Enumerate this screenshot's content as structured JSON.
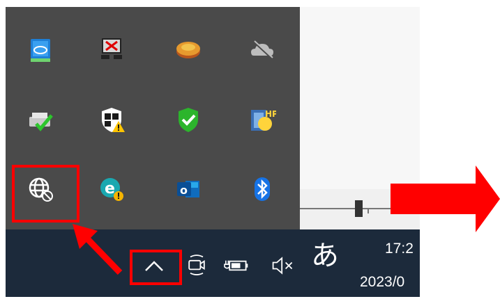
{
  "tray_overflow": {
    "icons": [
      {
        "name": "intel-graphics-icon",
        "row": 1,
        "col": 1
      },
      {
        "name": "network-disconnected-icon",
        "row": 1,
        "col": 2
      },
      {
        "name": "orange-disk-icon",
        "row": 1,
        "col": 3
      },
      {
        "name": "onedrive-offline-icon",
        "row": 1,
        "col": 4
      },
      {
        "name": "printer-check-icon",
        "row": 2,
        "col": 1
      },
      {
        "name": "windows-security-warning-icon",
        "row": 2,
        "col": 2
      },
      {
        "name": "shield-check-icon",
        "row": 2,
        "col": 3
      },
      {
        "name": "hp-app-icon",
        "row": 2,
        "col": 4
      },
      {
        "name": "globe-blocked-icon",
        "row": 3,
        "col": 1,
        "highlighted": true
      },
      {
        "name": "eset-warning-icon",
        "row": 3,
        "col": 2
      },
      {
        "name": "outlook-icon",
        "row": 3,
        "col": 3
      },
      {
        "name": "bluetooth-icon",
        "row": 3,
        "col": 4
      }
    ]
  },
  "taskbar": {
    "show_hidden_icons": "chevron-up-icon",
    "ime_mode": "あ",
    "clock_time": "17:2",
    "clock_date": "2023/0"
  },
  "colors": {
    "highlight": "#ff0000",
    "taskbar_bg": "#1c2a3b",
    "flyout_bg": "#4a4a4a"
  }
}
